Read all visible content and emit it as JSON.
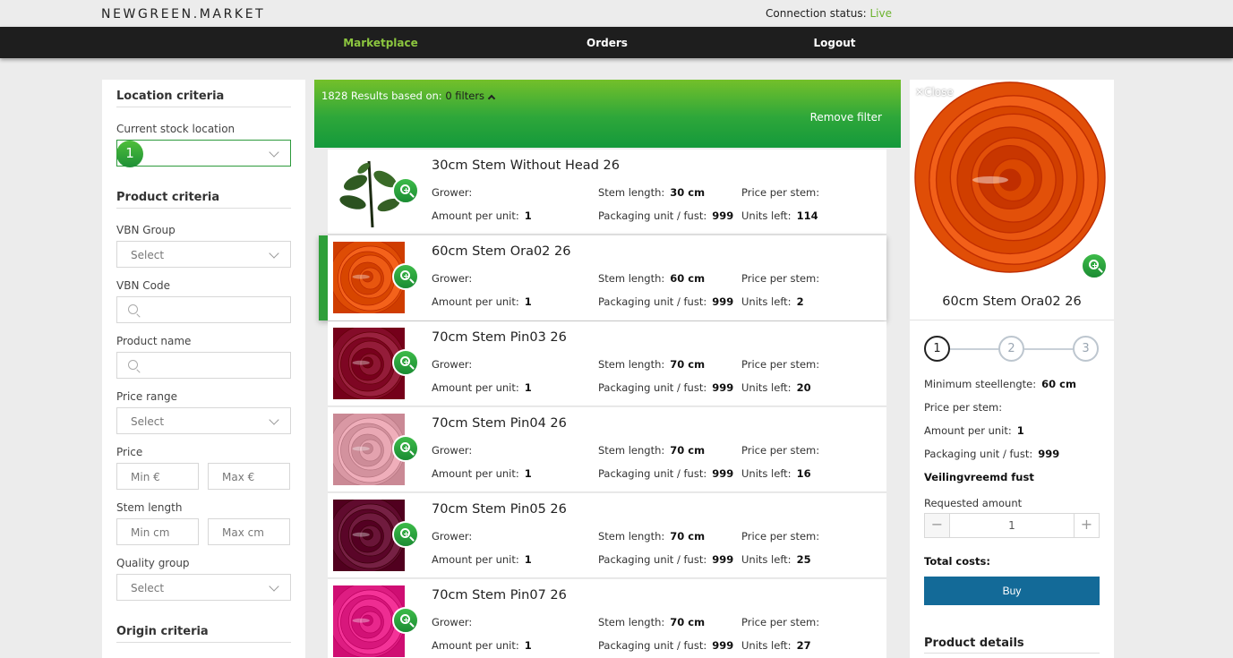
{
  "header": {
    "logo": "NEWGREEN.MARKET",
    "connection_label": "Connection status:",
    "connection_value": "Live"
  },
  "nav": {
    "marketplace": "Marketplace",
    "orders": "Orders",
    "logout": "Logout"
  },
  "filters": {
    "location_title": "Location criteria",
    "stock_location_label": "Current stock location",
    "stock_location_badge": "1",
    "product_title": "Product criteria",
    "vbn_group_label": "VBN Group",
    "vbn_group_value": "Select",
    "vbn_code_label": "VBN Code",
    "product_name_label": "Product name",
    "price_range_label": "Price range",
    "price_range_value": "Select",
    "price_label": "Price",
    "price_min_placeholder": "Min €",
    "price_max_placeholder": "Max €",
    "stem_length_label": "Stem length",
    "stem_min_placeholder": "Min cm",
    "stem_max_placeholder": "Max cm",
    "quality_group_label": "Quality group",
    "quality_group_value": "Select",
    "origin_title": "Origin criteria"
  },
  "results": {
    "count_text": "1828 Results based on:",
    "filters_text": "0 filters",
    "remove_filter": "Remove filter",
    "labels": {
      "grower": "Grower:",
      "amount": "Amount per unit:",
      "stem": "Stem length:",
      "packaging": "Packaging unit / fust:",
      "price": "Price per stem:",
      "units_left": "Units left:"
    },
    "items": [
      {
        "name": "30cm Stem Without Head 26",
        "stem": "30 cm",
        "amount": "1",
        "packaging": "999",
        "units_left": "114",
        "color": "#ffffff"
      },
      {
        "name": "60cm Stem Ora02 26",
        "stem": "60 cm",
        "amount": "1",
        "packaging": "999",
        "units_left": "2",
        "color": "#e8560f"
      },
      {
        "name": "70cm Stem Pin03 26",
        "stem": "70 cm",
        "amount": "1",
        "packaging": "999",
        "units_left": "20",
        "color": "#8e1633"
      },
      {
        "name": "70cm Stem Pin04 26",
        "stem": "70 cm",
        "amount": "1",
        "packaging": "999",
        "units_left": "16",
        "color": "#e3a2ae"
      },
      {
        "name": "70cm Stem Pin05 26",
        "stem": "70 cm",
        "amount": "1",
        "packaging": "999",
        "units_left": "25",
        "color": "#6a1538"
      },
      {
        "name": "70cm Stem Pin07 26",
        "stem": "70 cm",
        "amount": "1",
        "packaging": "999",
        "units_left": "27",
        "color": "#e8278c"
      }
    ]
  },
  "detail": {
    "close": "Close",
    "name": "60cm Stem Ora02 26",
    "steps": [
      "1",
      "2",
      "3"
    ],
    "min_stem_label": "Minimum steellengte:",
    "min_stem_value": "60 cm",
    "price_label": "Price per stem:",
    "amount_label": "Amount per unit:",
    "amount_value": "1",
    "packaging_label": "Packaging unit / fust:",
    "packaging_value": "999",
    "veiling": "Veilingvreemd fust",
    "requested_label": "Requested amount",
    "requested_value": "1",
    "minus": "−",
    "plus": "+",
    "total_label": "Total costs:",
    "buy": "Buy",
    "product_details": "Product details",
    "rose_color": "#e8560f"
  },
  "colors": {
    "accent_green": "#8cc63f",
    "live_green": "#6cb32e",
    "buy_blue": "#136a98",
    "navbar": "#1e1e1e"
  }
}
